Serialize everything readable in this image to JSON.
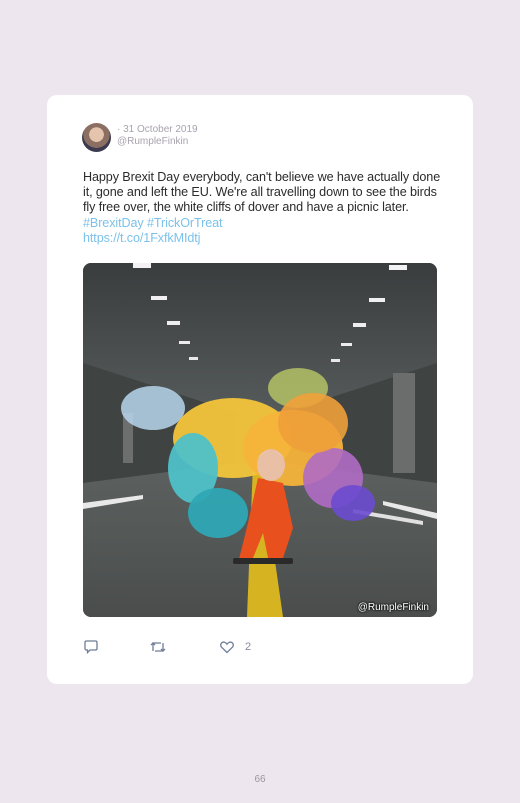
{
  "tweet": {
    "date": "· 31 October 2019",
    "handle": "@RumpleFinkin",
    "text_main": "Happy Brexit Day everybody, can't believe we have actually done it, gone and left the EU. We're all travelling down to see the birds fly free over, the white cliffs of dover and have a picnic later.",
    "hashtag1": "#BrexitDay",
    "hashtag2": "#TrickOrTreat",
    "link": "https://t.co/1FxfkMIdtj",
    "media_watermark": "@RumpleFinkin",
    "like_count": "2"
  },
  "icons": {
    "reply": "speech-bubble-icon",
    "retweet": "retweet-icon",
    "like": "heart-icon"
  },
  "page": {
    "number": "66"
  },
  "colors": {
    "background": "#ede6ee",
    "card": "#ffffff",
    "link": "#7cc1ea",
    "text": "#2b2b2b",
    "meta": "#a8a2ae"
  }
}
